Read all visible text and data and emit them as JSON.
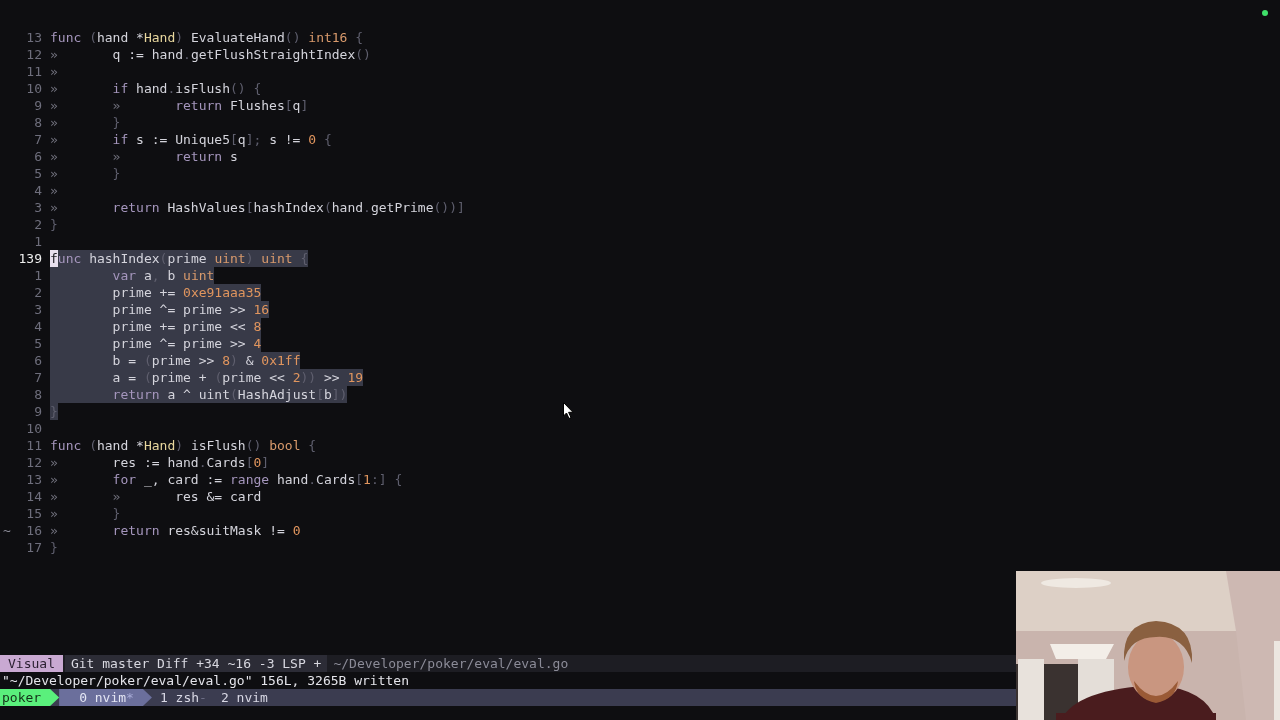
{
  "editor": {
    "lines": [
      {
        "number": "13",
        "current": false,
        "selected": false,
        "segments": [
          {
            "kind": "keyword",
            "text": "func"
          },
          {
            "kind": "punct",
            "text": " ("
          },
          {
            "kind": "plain",
            "text": "hand *"
          },
          {
            "kind": "struct",
            "text": "Hand"
          },
          {
            "kind": "punct",
            "text": ")"
          },
          {
            "kind": "plain",
            "text": " EvaluateHand"
          },
          {
            "kind": "punct",
            "text": "()"
          },
          {
            "kind": "type",
            "text": " int16"
          },
          {
            "kind": "punct",
            "text": " {"
          }
        ]
      },
      {
        "number": "12",
        "current": false,
        "selected": false,
        "segments": [
          {
            "kind": "tab",
            "text": "»"
          },
          {
            "kind": "plain",
            "text": "q := hand"
          },
          {
            "kind": "punct",
            "text": "."
          },
          {
            "kind": "plain",
            "text": "getFlushStraightIndex"
          },
          {
            "kind": "punct",
            "text": "()"
          }
        ]
      },
      {
        "number": "11",
        "current": false,
        "selected": false,
        "segments": [
          {
            "kind": "tab",
            "text": "»"
          }
        ]
      },
      {
        "number": "10",
        "current": false,
        "selected": false,
        "segments": [
          {
            "kind": "tab",
            "text": "»"
          },
          {
            "kind": "keyword",
            "text": "if"
          },
          {
            "kind": "plain",
            "text": " hand"
          },
          {
            "kind": "punct",
            "text": "."
          },
          {
            "kind": "plain",
            "text": "isFlush"
          },
          {
            "kind": "punct",
            "text": "() {"
          }
        ]
      },
      {
        "number": "9",
        "current": false,
        "selected": false,
        "segments": [
          {
            "kind": "tab",
            "text": "»"
          },
          {
            "kind": "tab",
            "text": "»"
          },
          {
            "kind": "keyword",
            "text": "return"
          },
          {
            "kind": "plain",
            "text": " Flushes"
          },
          {
            "kind": "punct",
            "text": "["
          },
          {
            "kind": "plain",
            "text": "q"
          },
          {
            "kind": "punct",
            "text": "]"
          }
        ]
      },
      {
        "number": "8",
        "current": false,
        "selected": false,
        "segments": [
          {
            "kind": "tab",
            "text": "»"
          },
          {
            "kind": "punct",
            "text": "}"
          }
        ]
      },
      {
        "number": "7",
        "current": false,
        "selected": false,
        "segments": [
          {
            "kind": "tab",
            "text": "»"
          },
          {
            "kind": "keyword",
            "text": "if"
          },
          {
            "kind": "plain",
            "text": " s := Unique5"
          },
          {
            "kind": "punct",
            "text": "["
          },
          {
            "kind": "plain",
            "text": "q"
          },
          {
            "kind": "punct",
            "text": "];"
          },
          {
            "kind": "plain",
            "text": " s != "
          },
          {
            "kind": "number",
            "text": "0"
          },
          {
            "kind": "punct",
            "text": " {"
          }
        ]
      },
      {
        "number": "6",
        "current": false,
        "selected": false,
        "segments": [
          {
            "kind": "tab",
            "text": "»"
          },
          {
            "kind": "tab",
            "text": "»"
          },
          {
            "kind": "keyword",
            "text": "return"
          },
          {
            "kind": "plain",
            "text": " s"
          }
        ]
      },
      {
        "number": "5",
        "current": false,
        "selected": false,
        "segments": [
          {
            "kind": "tab",
            "text": "»"
          },
          {
            "kind": "punct",
            "text": "}"
          }
        ]
      },
      {
        "number": "4",
        "current": false,
        "selected": false,
        "segments": [
          {
            "kind": "tab",
            "text": "»"
          }
        ]
      },
      {
        "number": "3",
        "current": false,
        "selected": false,
        "segments": [
          {
            "kind": "tab",
            "text": "»"
          },
          {
            "kind": "keyword",
            "text": "return"
          },
          {
            "kind": "plain",
            "text": " HashValues"
          },
          {
            "kind": "punct",
            "text": "["
          },
          {
            "kind": "plain",
            "text": "hashIndex"
          },
          {
            "kind": "punct",
            "text": "("
          },
          {
            "kind": "plain",
            "text": "hand"
          },
          {
            "kind": "punct",
            "text": "."
          },
          {
            "kind": "plain",
            "text": "getPrime"
          },
          {
            "kind": "punct",
            "text": "())]"
          }
        ]
      },
      {
        "number": "2",
        "current": false,
        "selected": false,
        "segments": [
          {
            "kind": "punct",
            "text": "}"
          }
        ]
      },
      {
        "number": "1",
        "current": false,
        "selected": false
      },
      {
        "number": "139",
        "current": true,
        "selected": true,
        "segments": [
          {
            "kind": "cursor",
            "text": "f"
          },
          {
            "kind": "keyword",
            "text": "unc"
          },
          {
            "kind": "plain",
            "text": " hashIndex"
          },
          {
            "kind": "punct",
            "text": "("
          },
          {
            "kind": "plain",
            "text": "prime "
          },
          {
            "kind": "type",
            "text": "uint"
          },
          {
            "kind": "punct",
            "text": ")"
          },
          {
            "kind": "type",
            "text": " uint"
          },
          {
            "kind": "punct",
            "text": " {"
          }
        ]
      },
      {
        "number": "1",
        "current": false,
        "selected": true,
        "segments": [
          {
            "kind": "keyword",
            "text": "        var"
          },
          {
            "kind": "plain",
            "text": " a"
          },
          {
            "kind": "punct",
            "text": ","
          },
          {
            "kind": "plain",
            "text": " b "
          },
          {
            "kind": "type",
            "text": "uint"
          }
        ]
      },
      {
        "number": "2",
        "current": false,
        "selected": true,
        "segments": [
          {
            "kind": "plain",
            "text": "        prime += "
          },
          {
            "kind": "number",
            "text": "0xe91aaa35"
          }
        ]
      },
      {
        "number": "3",
        "current": false,
        "selected": true,
        "segments": [
          {
            "kind": "plain",
            "text": "        prime ^= prime >> "
          },
          {
            "kind": "number",
            "text": "16"
          }
        ]
      },
      {
        "number": "4",
        "current": false,
        "selected": true,
        "segments": [
          {
            "kind": "plain",
            "text": "        prime += prime << "
          },
          {
            "kind": "number",
            "text": "8"
          }
        ]
      },
      {
        "number": "5",
        "current": false,
        "selected": true,
        "segments": [
          {
            "kind": "plain",
            "text": "        prime ^= prime >> "
          },
          {
            "kind": "number",
            "text": "4"
          }
        ]
      },
      {
        "number": "6",
        "current": false,
        "selected": true,
        "segments": [
          {
            "kind": "plain",
            "text": "        b = "
          },
          {
            "kind": "punct",
            "text": "("
          },
          {
            "kind": "plain",
            "text": "prime >> "
          },
          {
            "kind": "number",
            "text": "8"
          },
          {
            "kind": "punct",
            "text": ")"
          },
          {
            "kind": "plain",
            "text": " & "
          },
          {
            "kind": "number",
            "text": "0x1ff"
          }
        ]
      },
      {
        "number": "7",
        "current": false,
        "selected": true,
        "segments": [
          {
            "kind": "plain",
            "text": "        a = "
          },
          {
            "kind": "punct",
            "text": "("
          },
          {
            "kind": "plain",
            "text": "prime + "
          },
          {
            "kind": "punct",
            "text": "("
          },
          {
            "kind": "plain",
            "text": "prime << "
          },
          {
            "kind": "number",
            "text": "2"
          },
          {
            "kind": "punct",
            "text": "))"
          },
          {
            "kind": "plain",
            "text": " >> "
          },
          {
            "kind": "number",
            "text": "19"
          }
        ]
      },
      {
        "number": "8",
        "current": false,
        "selected": true,
        "segments": [
          {
            "kind": "keyword",
            "text": "        return"
          },
          {
            "kind": "plain",
            "text": " a ^ uint"
          },
          {
            "kind": "punct",
            "text": "("
          },
          {
            "kind": "plain",
            "text": "HashAdjust"
          },
          {
            "kind": "punct",
            "text": "["
          },
          {
            "kind": "plain",
            "text": "b"
          },
          {
            "kind": "punct",
            "text": "])"
          }
        ]
      },
      {
        "number": "9",
        "current": false,
        "selected": true,
        "segments": [
          {
            "kind": "punct",
            "text": "}"
          }
        ]
      },
      {
        "number": "10",
        "current": false,
        "selected": false
      },
      {
        "number": "11",
        "current": false,
        "selected": false,
        "segments": [
          {
            "kind": "keyword",
            "text": "func"
          },
          {
            "kind": "punct",
            "text": " ("
          },
          {
            "kind": "plain",
            "text": "hand *"
          },
          {
            "kind": "struct",
            "text": "Hand"
          },
          {
            "kind": "punct",
            "text": ")"
          },
          {
            "kind": "plain",
            "text": " isFlush"
          },
          {
            "kind": "punct",
            "text": "()"
          },
          {
            "kind": "type",
            "text": " bool"
          },
          {
            "kind": "punct",
            "text": " {"
          }
        ]
      },
      {
        "number": "12",
        "current": false,
        "selected": false,
        "segments": [
          {
            "kind": "tab",
            "text": "»"
          },
          {
            "kind": "plain",
            "text": "res := hand"
          },
          {
            "kind": "punct",
            "text": "."
          },
          {
            "kind": "plain",
            "text": "Cards"
          },
          {
            "kind": "punct",
            "text": "["
          },
          {
            "kind": "number",
            "text": "0"
          },
          {
            "kind": "punct",
            "text": "]"
          }
        ]
      },
      {
        "number": "13",
        "current": false,
        "selected": false,
        "segments": [
          {
            "kind": "tab",
            "text": "»"
          },
          {
            "kind": "keyword",
            "text": "for"
          },
          {
            "kind": "plain",
            "text": " _, card := "
          },
          {
            "kind": "keyword",
            "text": "range"
          },
          {
            "kind": "plain",
            "text": " hand"
          },
          {
            "kind": "punct",
            "text": "."
          },
          {
            "kind": "plain",
            "text": "Cards"
          },
          {
            "kind": "punct",
            "text": "["
          },
          {
            "kind": "number",
            "text": "1"
          },
          {
            "kind": "punct",
            "text": ":] {"
          }
        ]
      },
      {
        "number": "14",
        "current": false,
        "selected": false,
        "segments": [
          {
            "kind": "tab",
            "text": "»"
          },
          {
            "kind": "tab",
            "text": "»"
          },
          {
            "kind": "plain",
            "text": "res &= card"
          }
        ]
      },
      {
        "number": "15",
        "current": false,
        "selected": false,
        "segments": [
          {
            "kind": "tab",
            "text": "»"
          },
          {
            "kind": "punct",
            "text": "}"
          }
        ]
      },
      {
        "number": "16",
        "sign": "~",
        "current": false,
        "selected": false,
        "segments": [
          {
            "kind": "tab",
            "text": "»"
          },
          {
            "kind": "keyword",
            "text": "return"
          },
          {
            "kind": "plain",
            "text": " res&suitMask != "
          },
          {
            "kind": "number",
            "text": "0"
          }
        ]
      },
      {
        "number": "17",
        "current": false,
        "selected": false,
        "segments": [
          {
            "kind": "punct",
            "text": "}"
          }
        ]
      }
    ]
  },
  "status_line": {
    "mode": "Visual",
    "info": "Git master Diff +34 ~16 -3 LSP +",
    "path": "~/Developer/poker/eval/eval.go"
  },
  "message": "\"~/Developer/poker/eval/eval.go\" 156L, 3265B written",
  "tmux": {
    "session": "poker",
    "windows": [
      {
        "label": "0 nvim",
        "flag": "*",
        "selected": true
      },
      {
        "label": "1 zsh",
        "flag": "-",
        "selected": false
      },
      {
        "label": "2 nvim",
        "selected": false
      }
    ]
  }
}
